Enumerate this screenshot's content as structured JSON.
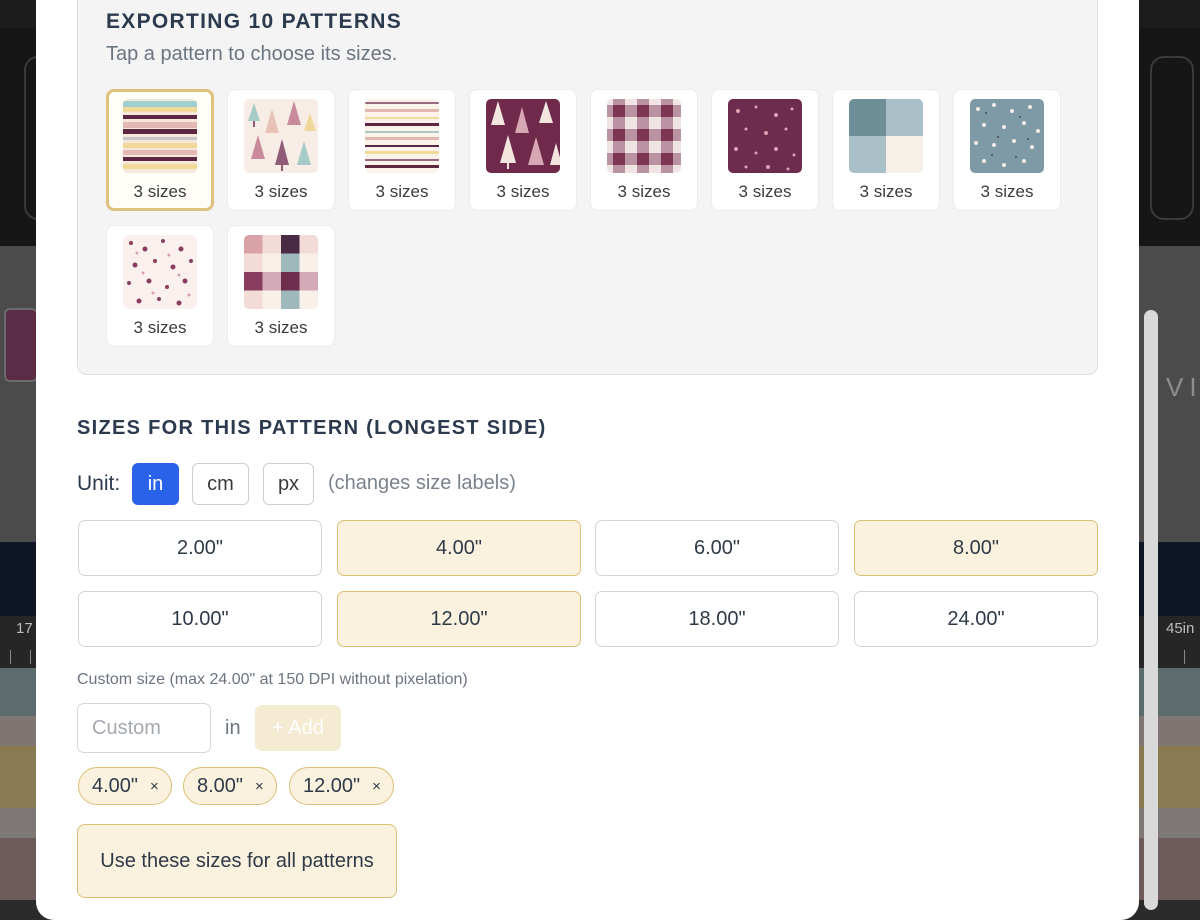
{
  "background": {
    "ruler_left": "17",
    "ruler_right": "45in",
    "header_right_text": "VI"
  },
  "export": {
    "title": "EXPORTING 10 PATTERNS",
    "subtitle": "Tap a pattern to choose its sizes.",
    "patterns": [
      {
        "label": "3 sizes",
        "swatch": "stripes-multicolor",
        "selected": true
      },
      {
        "label": "3 sizes",
        "swatch": "pastel-trees"
      },
      {
        "label": "3 sizes",
        "swatch": "thin-stripes"
      },
      {
        "label": "3 sizes",
        "swatch": "plum-trees"
      },
      {
        "label": "3 sizes",
        "swatch": "plum-gingham"
      },
      {
        "label": "3 sizes",
        "swatch": "plum-floral"
      },
      {
        "label": "3 sizes",
        "swatch": "blue-color-block"
      },
      {
        "label": "3 sizes",
        "swatch": "blue-floral"
      },
      {
        "label": "3 sizes",
        "swatch": "white-floral"
      },
      {
        "label": "3 sizes",
        "swatch": "patchwork-plaid"
      }
    ]
  },
  "sizes": {
    "title": "SIZES FOR THIS PATTERN (LONGEST SIDE)",
    "unit_label": "Unit:",
    "units": [
      "in",
      "cm",
      "px"
    ],
    "active_unit": "in",
    "unit_hint": "(changes size labels)",
    "options": [
      {
        "label": "2.00\"",
        "selected": false
      },
      {
        "label": "4.00\"",
        "selected": true
      },
      {
        "label": "6.00\"",
        "selected": false
      },
      {
        "label": "8.00\"",
        "selected": true
      },
      {
        "label": "10.00\"",
        "selected": false
      },
      {
        "label": "12.00\"",
        "selected": true
      },
      {
        "label": "18.00\"",
        "selected": false
      },
      {
        "label": "24.00\"",
        "selected": false
      }
    ],
    "custom_note": "Custom size (max 24.00\" at 150 DPI without pixelation)",
    "custom_placeholder": "Custom",
    "custom_unit": "in",
    "add_label": "+ Add",
    "chips": [
      {
        "label": "4.00\"",
        "remove": "×"
      },
      {
        "label": "8.00\"",
        "remove": "×"
      },
      {
        "label": "12.00\"",
        "remove": "×"
      }
    ],
    "apply_label": "Use these sizes for all patterns"
  },
  "colors": {
    "accent": "#2a62e9",
    "selected_fill": "#faf2df",
    "selected_border": "#dcbf77",
    "heading": "#2c3a4e"
  }
}
